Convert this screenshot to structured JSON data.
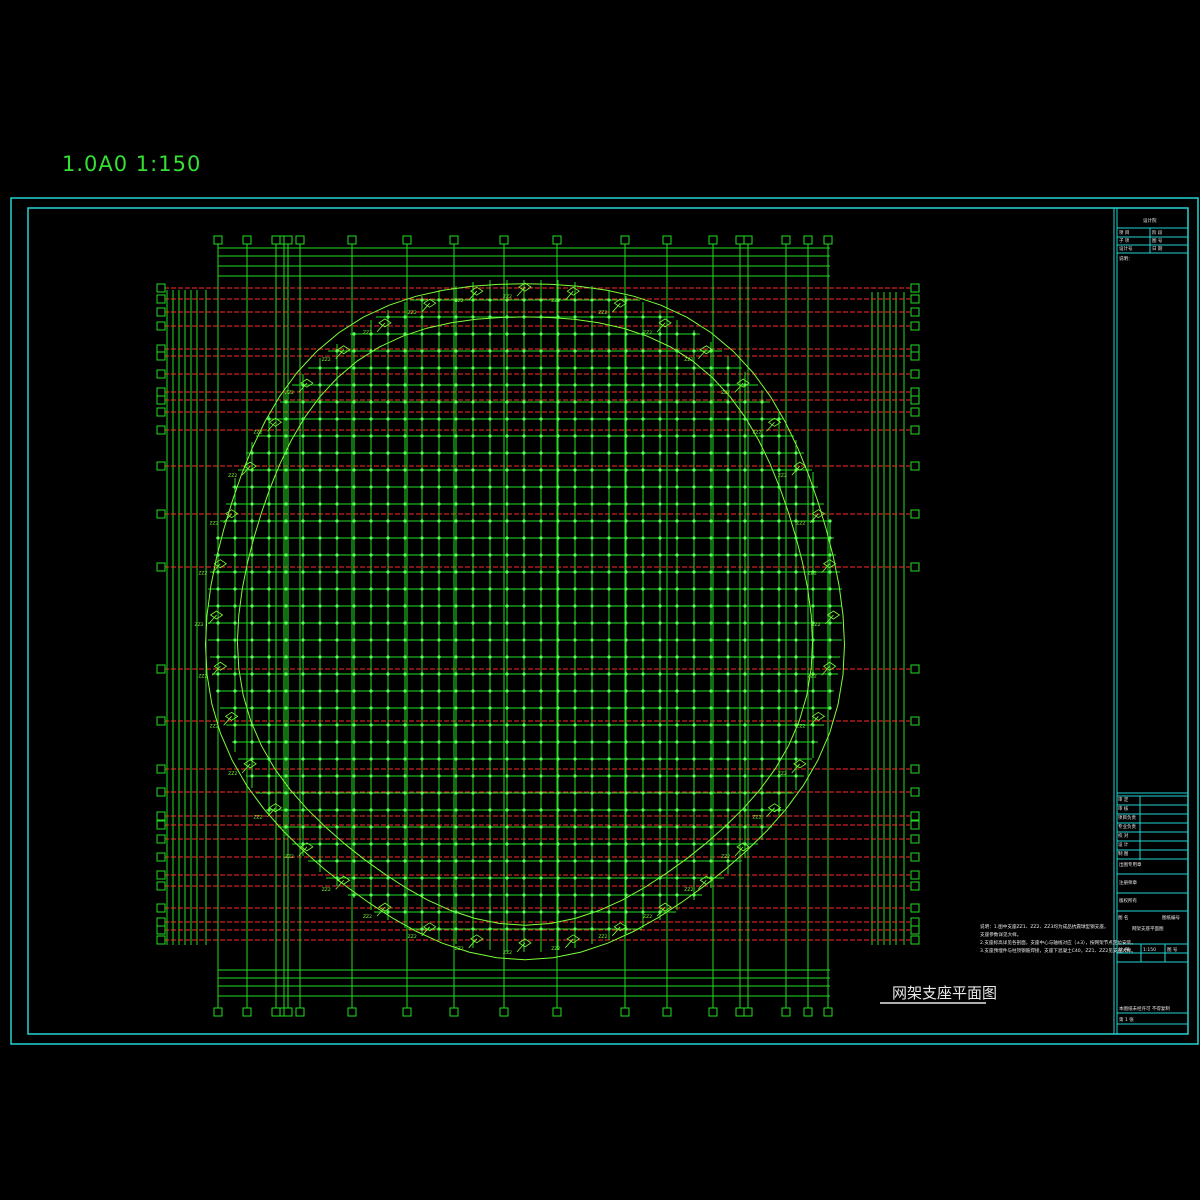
{
  "header": {
    "scale_label": "1.0A0   1:150"
  },
  "drawing": {
    "title": "网架支座平面图",
    "support_tag": "ZZ2"
  },
  "notes": {
    "lines": [
      "说明：1.图中支座ZZ1、ZZ2、ZZ3均为成品抗震球型钢支座，",
      "支座参数详见大样。",
      "2.支座标高详见各剖面，支座中心与轴线对应（±3），按网架节点定位安装。",
      "3.支座预埋件与柱顶钢筋焊接，支座下混凝土C40，ZZ1、ZZ2见支座大样。"
    ]
  },
  "title_block": {
    "company": "设计院",
    "rows_top": [
      "项 目",
      "子 项",
      "设计号"
    ],
    "rows_top_right": [
      "阶 段",
      "图 号",
      "日 期"
    ],
    "notes_label": "说明：",
    "sign_rows": [
      "审 定",
      "审 核",
      "项目负责",
      "专业负责",
      "校 对",
      "设 计",
      "制 图"
    ],
    "stamp_label": "出图专用章",
    "cert_label": "注册师章",
    "drawing_name_label": "图 名",
    "drawing_name": "网架支座平面图",
    "drawing_no_label": "图 号",
    "sheet_label": "比 例",
    "scale_value": "1:150",
    "footer_1": "本图纸未经许可 不得复制",
    "footer_2": "版权所有",
    "footer_3": "图纸编号",
    "footer_4": "第 1 张"
  },
  "colors": {
    "frame": "#22d3d3",
    "grid": "#22dd22",
    "axis": "#ff2a2a",
    "member": "#7cff3a",
    "text": "#e8e8e8"
  }
}
